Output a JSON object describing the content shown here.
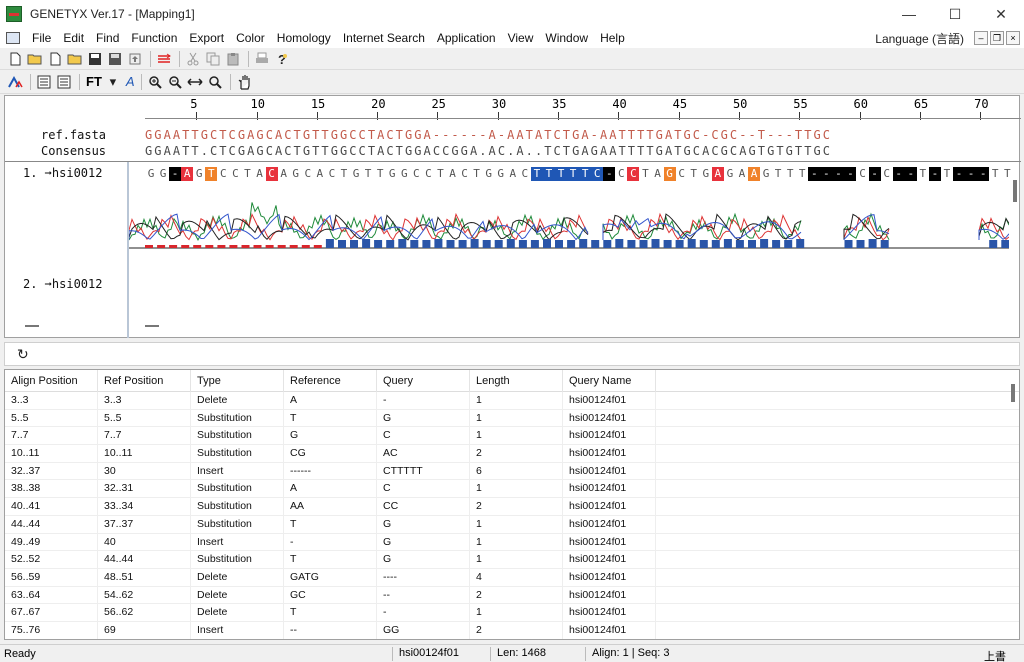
{
  "window": {
    "title": "GENETYX Ver.17 - [Mapping1]",
    "minimize": "—",
    "maximize": "☐",
    "close": "✕"
  },
  "menu": {
    "items": [
      "File",
      "Edit",
      "Find",
      "Function",
      "Export",
      "Color",
      "Homology",
      "Internet Search",
      "Application",
      "View",
      "Window",
      "Help"
    ],
    "language": "Language (言語)",
    "mdi_min": "–",
    "mdi_restore": "❐",
    "mdi_close": "×"
  },
  "toolbar": {
    "ft_label": "FT",
    "a_label": "A"
  },
  "ruler": {
    "numbers": [
      "5",
      "10",
      "15",
      "20",
      "25",
      "30",
      "35",
      "40",
      "45",
      "50",
      "55",
      "60",
      "65",
      "70"
    ]
  },
  "sequences": {
    "ref_label": "ref.fasta",
    "cons_label": "Consensus",
    "ref_seq": "GGAATTGCTCGAGCACTGTTGGCCTACTGGA------A-AATATCTGA-AATTTTGATGC-CGC--T---TTGC",
    "cons_seq": "GGAATT.CTCGAGCACTGTTGGCCTACTGGACCGGA.AC.A..TCTGAGAATTTTGATGCACGCAGTGTGTTGC",
    "row1_label": "1. ➞hsi0012",
    "row2_label": "2. ➞hsi0012",
    "row1_seq": "GG-AGTCCTACAGCACTGTTGGCCTACTGGACTTTTTC-CCTAGCTGAGAAGTTT----C-C--T-T---TT"
  },
  "colors": {
    "ref_text": "#c25a4a",
    "sub_red": "#e8323c",
    "sub_orange": "#f0822a",
    "ins_blue": "#1f57b5",
    "del_black": "#000000",
    "quality_blue": "#2a55a8",
    "quality_red": "#d8262c"
  },
  "table": {
    "headers": [
      "Align Position",
      "Ref Position",
      "Type",
      "Reference",
      "Query",
      "Length",
      "Query Name",
      ""
    ],
    "rows": [
      [
        "3..3",
        "3..3",
        "Delete",
        "A",
        "-",
        "1",
        "hsi00124f01"
      ],
      [
        "5..5",
        "5..5",
        "Substitution",
        "T",
        "G",
        "1",
        "hsi00124f01"
      ],
      [
        "7..7",
        "7..7",
        "Substitution",
        "G",
        "C",
        "1",
        "hsi00124f01"
      ],
      [
        "10..11",
        "10..11",
        "Substitution",
        "CG",
        "AC",
        "2",
        "hsi00124f01"
      ],
      [
        "32..37",
        "30",
        "Insert",
        "------",
        "CTTTTT",
        "6",
        "hsi00124f01"
      ],
      [
        "38..38",
        "32..31",
        "Substitution",
        "A",
        "C",
        "1",
        "hsi00124f01"
      ],
      [
        "40..41",
        "33..34",
        "Substitution",
        "AA",
        "CC",
        "2",
        "hsi00124f01"
      ],
      [
        "44..44",
        "37..37",
        "Substitution",
        "T",
        "G",
        "1",
        "hsi00124f01"
      ],
      [
        "49..49",
        "40",
        "Insert",
        "-",
        "G",
        "1",
        "hsi00124f01"
      ],
      [
        "52..52",
        "44..44",
        "Substitution",
        "T",
        "G",
        "1",
        "hsi00124f01"
      ],
      [
        "56..59",
        "48..51",
        "Delete",
        "GATG",
        "----",
        "4",
        "hsi00124f01"
      ],
      [
        "63..64",
        "54..62",
        "Delete",
        "GC",
        "--",
        "2",
        "hsi00124f01"
      ],
      [
        "67..67",
        "56..62",
        "Delete",
        "T",
        "-",
        "1",
        "hsi00124f01"
      ],
      [
        "75..76",
        "69",
        "Insert",
        "--",
        "GG",
        "2",
        "hsi00124f01"
      ]
    ]
  },
  "status": {
    "ready": "Ready",
    "query": "hsi00124f01",
    "length": "Len: 1468",
    "align": "Align: 1 | Seq: 3",
    "mode": "上書"
  }
}
